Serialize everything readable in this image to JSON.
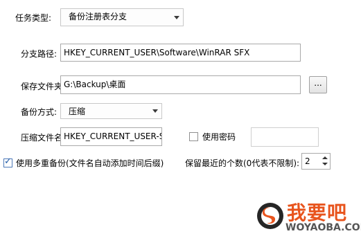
{
  "task_type": {
    "label": "任务类型:",
    "selected": "备份注册表分支"
  },
  "branch_path": {
    "label": "分支路径:",
    "value": "HKEY_CURRENT_USER\\Software\\WinRAR SFX"
  },
  "save_folder": {
    "label": "保存文件夹:",
    "value": "G:\\Backup\\桌面",
    "browse_label": "..."
  },
  "backup_mode": {
    "label": "备份方式:",
    "selected": "压缩"
  },
  "archive_name": {
    "label": "压缩文件名:",
    "value": "HKEY_CURRENT_USER-S"
  },
  "password": {
    "label": "使用密码",
    "checked": false,
    "value": ""
  },
  "multi_backup": {
    "label": "使用多重备份(文件名自动添加时间后缀)",
    "checked": true
  },
  "keep_count": {
    "label": "保留最近的个数(0代表不限制):",
    "value": "2"
  },
  "watermark": {
    "brand_text": "我要吧",
    "domain_text": "WOYAOBA.COM",
    "brand_color": "#e8541d"
  }
}
